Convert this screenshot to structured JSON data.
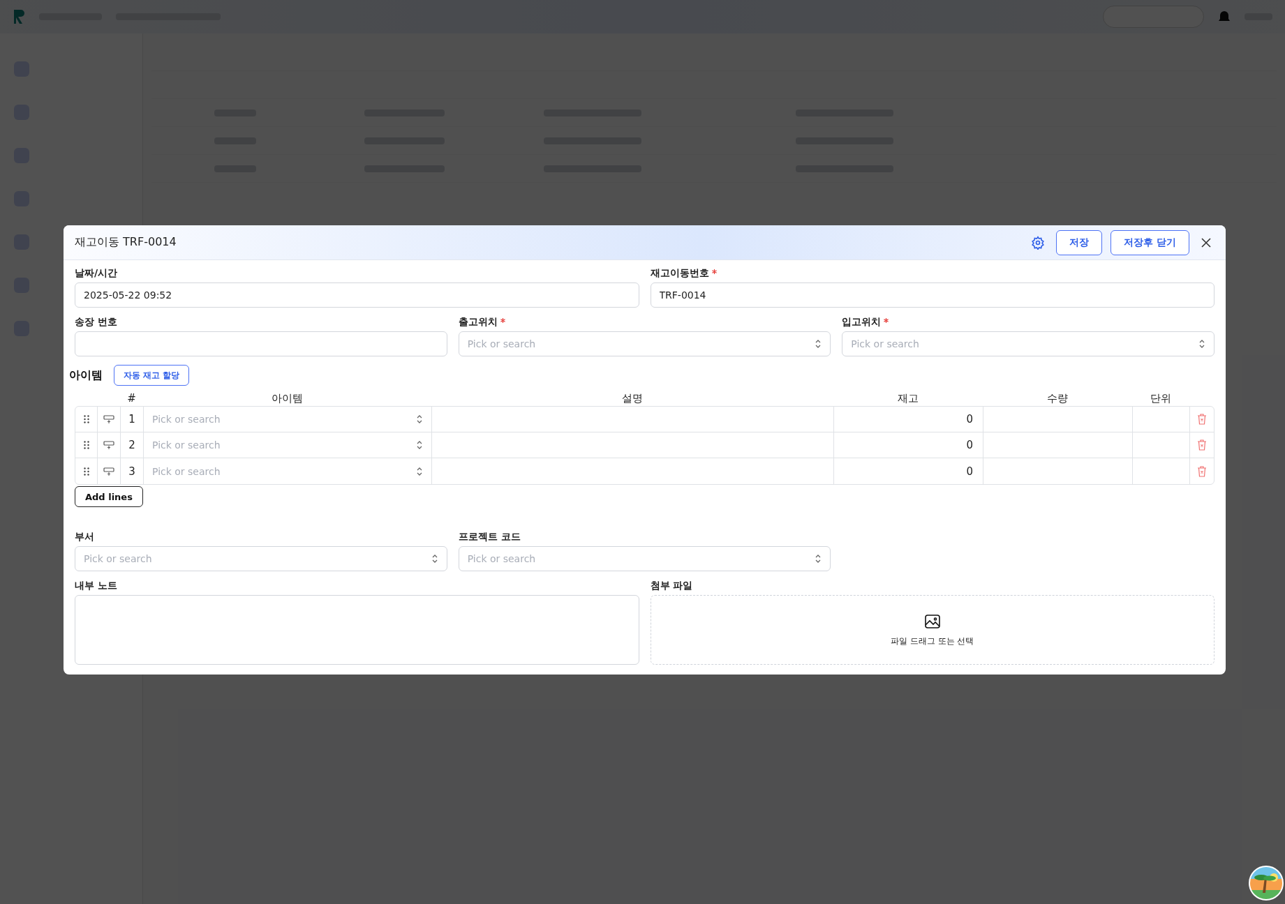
{
  "modal": {
    "title": "재고이동 TRF-0014",
    "buttons": [
      "저장",
      "저장후 닫기"
    ],
    "rows": [
      [
        {
          "label": "날짜/시간",
          "kind": "text",
          "required": false,
          "value": "2025-05-22 09:52"
        },
        {
          "label": "재고이동번호",
          "kind": "text",
          "required": true,
          "value": "TRF-0014"
        }
      ],
      [
        {
          "label": "송장 번호",
          "kind": "text",
          "required": false
        },
        {
          "label": "출고위치",
          "kind": "select",
          "required": true,
          "placeholder": "Pick or search"
        },
        {
          "label": "입고위치",
          "kind": "select",
          "required": true,
          "placeholder": "Pick or search"
        }
      ]
    ],
    "items": {
      "title": "아이템",
      "auto_button": "자동 재고 할당",
      "columns": [
        "#",
        "아이템",
        "설명",
        "재고",
        "수량",
        "단위"
      ],
      "rows": [
        {
          "number": "1",
          "item_placeholder": "Pick or search",
          "stock": "0"
        },
        {
          "number": "2",
          "item_placeholder": "Pick or search",
          "stock": "0"
        },
        {
          "number": "3",
          "item_placeholder": "Pick or search",
          "stock": "0"
        }
      ],
      "add_button": "Add lines"
    },
    "lower_fields": [
      {
        "label": "부서",
        "kind": "select",
        "required": false,
        "placeholder": "Pick or search"
      },
      {
        "label": "프로젝트 코드",
        "kind": "select",
        "required": false,
        "placeholder": "Pick or search"
      }
    ],
    "notes": {
      "label": "내부 노트"
    },
    "attachment": {
      "label": "첨부 파일",
      "hint": "파일 드래그 또는 선택"
    }
  }
}
